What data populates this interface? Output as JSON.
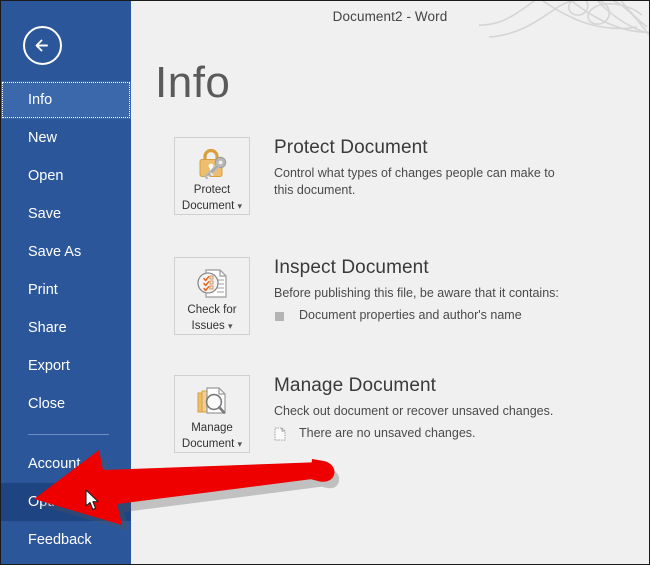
{
  "window": {
    "title": "Document2 - Word",
    "decoration_icon": "calligraphic-swirl-ornament"
  },
  "sidebar": {
    "back_icon": "back-arrow-icon",
    "items": [
      {
        "label": "Info",
        "state": "selected"
      },
      {
        "label": "New",
        "state": "normal"
      },
      {
        "label": "Open",
        "state": "normal"
      },
      {
        "label": "Save",
        "state": "normal"
      },
      {
        "label": "Save As",
        "state": "normal"
      },
      {
        "label": "Print",
        "state": "normal"
      },
      {
        "label": "Share",
        "state": "normal"
      },
      {
        "label": "Export",
        "state": "normal"
      },
      {
        "label": "Close",
        "state": "normal"
      },
      {
        "label": "Account",
        "state": "normal"
      },
      {
        "label": "Options",
        "state": "hover"
      },
      {
        "label": "Feedback",
        "state": "normal"
      }
    ]
  },
  "main": {
    "page_title": "Info",
    "sections": [
      {
        "button_label_line1": "Protect",
        "button_label_line2": "Document",
        "button_icon": "padlock-key-icon",
        "title": "Protect Document",
        "description": "Control what types of changes people can make to this document.",
        "bullet_icon": "",
        "bullet_text": ""
      },
      {
        "button_label_line1": "Check for",
        "button_label_line2": "Issues",
        "button_icon": "document-inspect-checkmarks-icon",
        "title": "Inspect Document",
        "description": "Before publishing this file, be aware that it contains:",
        "bullet_icon": "gray-square-bullet",
        "bullet_text": "Document properties and author's name"
      },
      {
        "button_label_line1": "Manage",
        "button_label_line2": "Document",
        "button_icon": "stacked-documents-magnifier-icon",
        "title": "Manage Document",
        "description": "Check out document or recover unsaved changes.",
        "bullet_icon": "dotted-document-icon",
        "bullet_text": "There are no unsaved changes."
      }
    ]
  },
  "annotations": {
    "arrow_color": "#ee0000",
    "arrow_target": "Options",
    "cursor_icon": "mouse-pointer-icon"
  },
  "colors": {
    "brand_blue": "#2b579a",
    "selected_blue": "#3a68ab",
    "hover_blue": "#1f4482",
    "content_bg": "#f0f0f0",
    "gold": "#e8bb6a",
    "arrow_red": "#ee0000"
  }
}
